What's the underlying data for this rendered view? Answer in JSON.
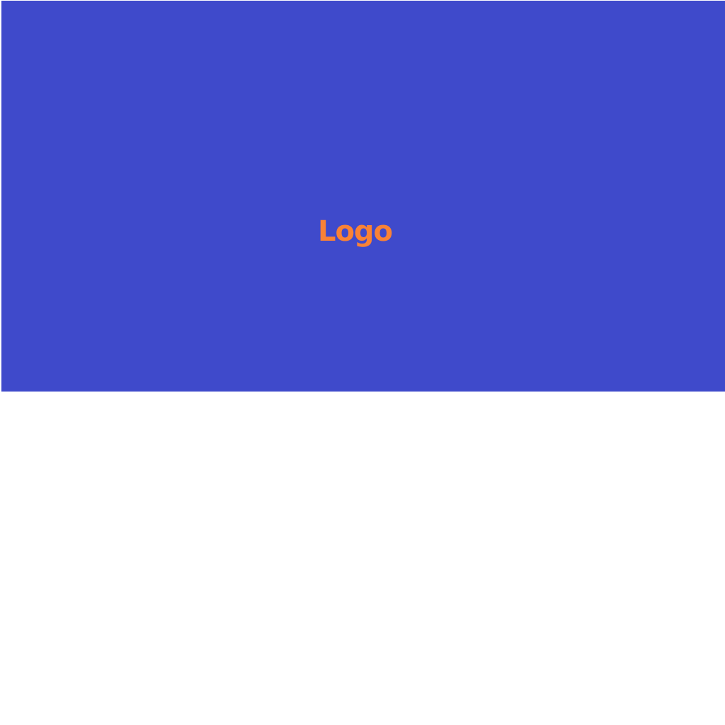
{
  "hero": {
    "logo_text": "Logo",
    "background_color": "#3F4ACB",
    "logo_color": "#F98236"
  },
  "page": {
    "background_color": "#FFFFFF"
  }
}
